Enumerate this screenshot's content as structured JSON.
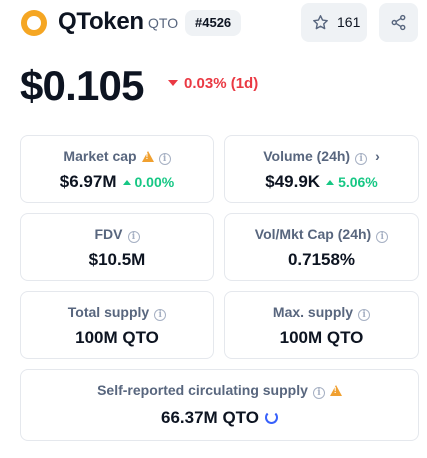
{
  "coin": {
    "name": "QToken",
    "symbol": "QTO",
    "rank": "#4526",
    "watchlist_count": "161",
    "logo_color": "#f5a623"
  },
  "price": {
    "value": "$0.105",
    "change": "0.03% (1d)",
    "change_direction": "down",
    "change_color": "#ea3943"
  },
  "stats": {
    "market_cap": {
      "label": "Market cap",
      "value": "$6.97M",
      "change": "0.00%",
      "icons": [
        "warning-icon",
        "info-icon"
      ]
    },
    "volume": {
      "label": "Volume (24h)",
      "value": "$49.9K",
      "change": "5.06%",
      "icons": [
        "info-icon",
        "chevron-right-icon"
      ]
    },
    "fdv": {
      "label": "FDV",
      "value": "$10.5M"
    },
    "vol_mkt_cap": {
      "label": "Vol/Mkt Cap (24h)",
      "value": "0.7158%"
    },
    "total_supply": {
      "label": "Total supply",
      "value": "100M QTO"
    },
    "max_supply": {
      "label": "Max. supply",
      "value": "100M QTO"
    },
    "circulating_supply": {
      "label": "Self-reported circulating supply",
      "value": "66.37M QTO"
    }
  },
  "colors": {
    "positive": "#16c784",
    "negative": "#ea3943",
    "warning": "#f0a030",
    "accent": "#3861fb"
  }
}
